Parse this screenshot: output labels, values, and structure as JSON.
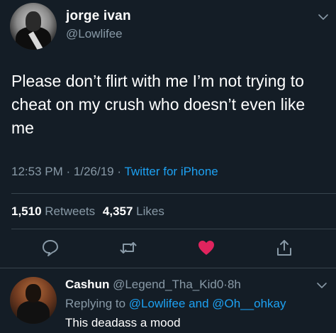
{
  "tweet": {
    "author": {
      "display_name": "jorge ivan",
      "handle": "@Lowlifee"
    },
    "text": "Please don’t flirt with me I’m not trying to cheat on my crush who doesn’t even like me",
    "time": "12:53 PM",
    "date": "1/26/19",
    "separator": "·",
    "source": "Twitter for iPhone",
    "retweets_count": "1,510",
    "retweets_label": "Retweets",
    "likes_count": "4,357",
    "likes_label": "Likes",
    "actions": {
      "reply_icon": "speech-bubble",
      "retweet_icon": "retweet-arrows",
      "like_icon": "heart",
      "share_icon": "share-arrow",
      "like_color": "#e0245e"
    }
  },
  "reply": {
    "display_name": "Cashun",
    "handle": "@Legend_Tha_Kid0",
    "separator": "·",
    "age": "8h",
    "replying_to_label": "Replying to",
    "mention_1": "@Lowlifee",
    "and_label": "and",
    "mention_2": "@Oh__ohkay",
    "text": "This deadass a mood"
  },
  "colors": {
    "background": "#141d26",
    "secondary_text": "#8899a6",
    "accent": "#1da1f2",
    "divider": "#38444d"
  }
}
